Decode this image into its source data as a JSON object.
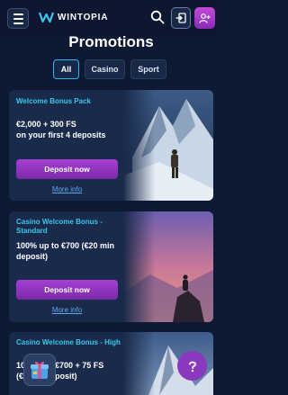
{
  "header": {
    "logo_text": "WINTOPIA",
    "menu_icon": "hamburger-icon",
    "search_icon": "search-icon",
    "login_icon": "login-icon",
    "signup_icon": "add-user-icon"
  },
  "page": {
    "title": "Promotions"
  },
  "tabs": [
    {
      "label": "All",
      "active": true
    },
    {
      "label": "Casino",
      "active": false
    },
    {
      "label": "Sport",
      "active": false
    }
  ],
  "promos": [
    {
      "label": "Welcome Bonus Pack",
      "headline": "€2,000 + 300 FS on your first 4 deposits",
      "headline_line1": "€2,000 + 300 FS",
      "headline_line2": "on your first 4 deposits",
      "button": "Deposit now",
      "link": "More info"
    },
    {
      "label": "Casino Welcome Bonus - Standard",
      "label_line1": "Casino Welcome Bonus -",
      "label_line2": "Standard",
      "headline_line1": "100% up to €700 (€20 min",
      "headline_line2": "deposit)",
      "button": "Deposit now",
      "link": "More info"
    },
    {
      "label": "Casino Welcome Bonus - High",
      "headline_line1": "100% up to €700 + 75 FS",
      "headline_line2": "(€... deposit)",
      "visible_line1": "10",
      "visible_line1b": "€700 + 75 FS",
      "visible_line2a": "(€",
      "visible_line2b": "eposit)"
    }
  ],
  "colors": {
    "background": "#0e1a33",
    "accent_cyan": "#38c8ef",
    "button_purple": "#a63ed5",
    "chat_purple": "#8a38bd"
  }
}
